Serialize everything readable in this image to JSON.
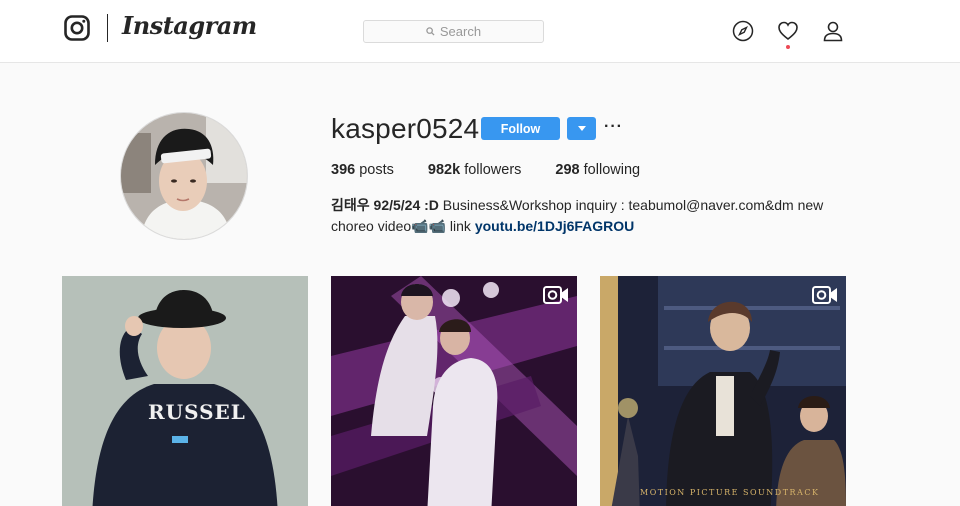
{
  "nav": {
    "wordmark": "Instagram",
    "search_placeholder": "Search",
    "icons": [
      "instagram-glyph-icon",
      "search-icon",
      "compass-icon",
      "heart-icon",
      "user-icon"
    ],
    "notification_color": "#ed4956"
  },
  "profile": {
    "username": "kasper0524",
    "follow_label": "Follow",
    "more_label": "···",
    "posts_count": "396",
    "posts_label": "posts",
    "followers_count": "982k",
    "followers_label": "followers",
    "following_count": "298",
    "following_label": "following",
    "bio_name": "김태우 92/5/24 :D",
    "bio_text": " Business&Workshop inquiry : teabumol@naver.com&dm new choreo video📹📹 link ",
    "bio_link": "youtu.be/1DJj6FAGROU"
  },
  "posts": [
    {
      "type": "photo",
      "caption": "RUSSEL"
    },
    {
      "type": "video",
      "icon": "video-camera-icon"
    },
    {
      "type": "video",
      "icon": "video-camera-icon",
      "caption": "MOTION PICTURE SOUNDTRACK"
    }
  ],
  "colors": {
    "accent": "#3897f0",
    "link": "#003569",
    "text": "#262626",
    "background": "#fafafa"
  }
}
